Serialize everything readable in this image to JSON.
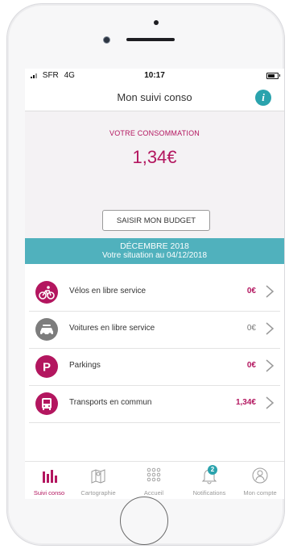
{
  "status_bar": {
    "carrier": "SFR",
    "network": "4G",
    "time": "10:17"
  },
  "header": {
    "title": "Mon suivi conso",
    "info_glyph": "i"
  },
  "consumption": {
    "label": "VOTRE CONSOMMATION",
    "amount": "1,34€"
  },
  "budget_button": {
    "label": "SAISIR MON BUDGET"
  },
  "period_banner": {
    "month": "DÉCEMBRE 2018",
    "situation": "Votre situation au 04/12/2018"
  },
  "categories": [
    {
      "label": "Vélos en libre service",
      "value": "0€",
      "icon": "bicycle-icon",
      "color": "#b3165f"
    },
    {
      "label": "Voitures en libre service",
      "value": "0€",
      "icon": "car-icon",
      "color": "#7d7d7d"
    },
    {
      "label": "Parkings",
      "value": "0€",
      "icon": "parking-icon",
      "color": "#b3165f",
      "glyph": "P"
    },
    {
      "label": "Transports en commun",
      "value": "1,34€",
      "icon": "bus-icon",
      "color": "#b3165f"
    }
  ],
  "tabs": [
    {
      "label": "Suivi conso",
      "icon": "bar-chart-icon",
      "active": true
    },
    {
      "label": "Cartographie",
      "icon": "map-icon",
      "active": false
    },
    {
      "label": "Accueil",
      "icon": "grid-icon",
      "active": false
    },
    {
      "label": "Notifications",
      "icon": "bell-icon",
      "active": false,
      "badge": "2"
    },
    {
      "label": "Mon compte",
      "icon": "user-icon",
      "active": false
    }
  ],
  "colors": {
    "accent": "#b3165f",
    "teal": "#50b1bd",
    "info": "#2aa3ad"
  }
}
